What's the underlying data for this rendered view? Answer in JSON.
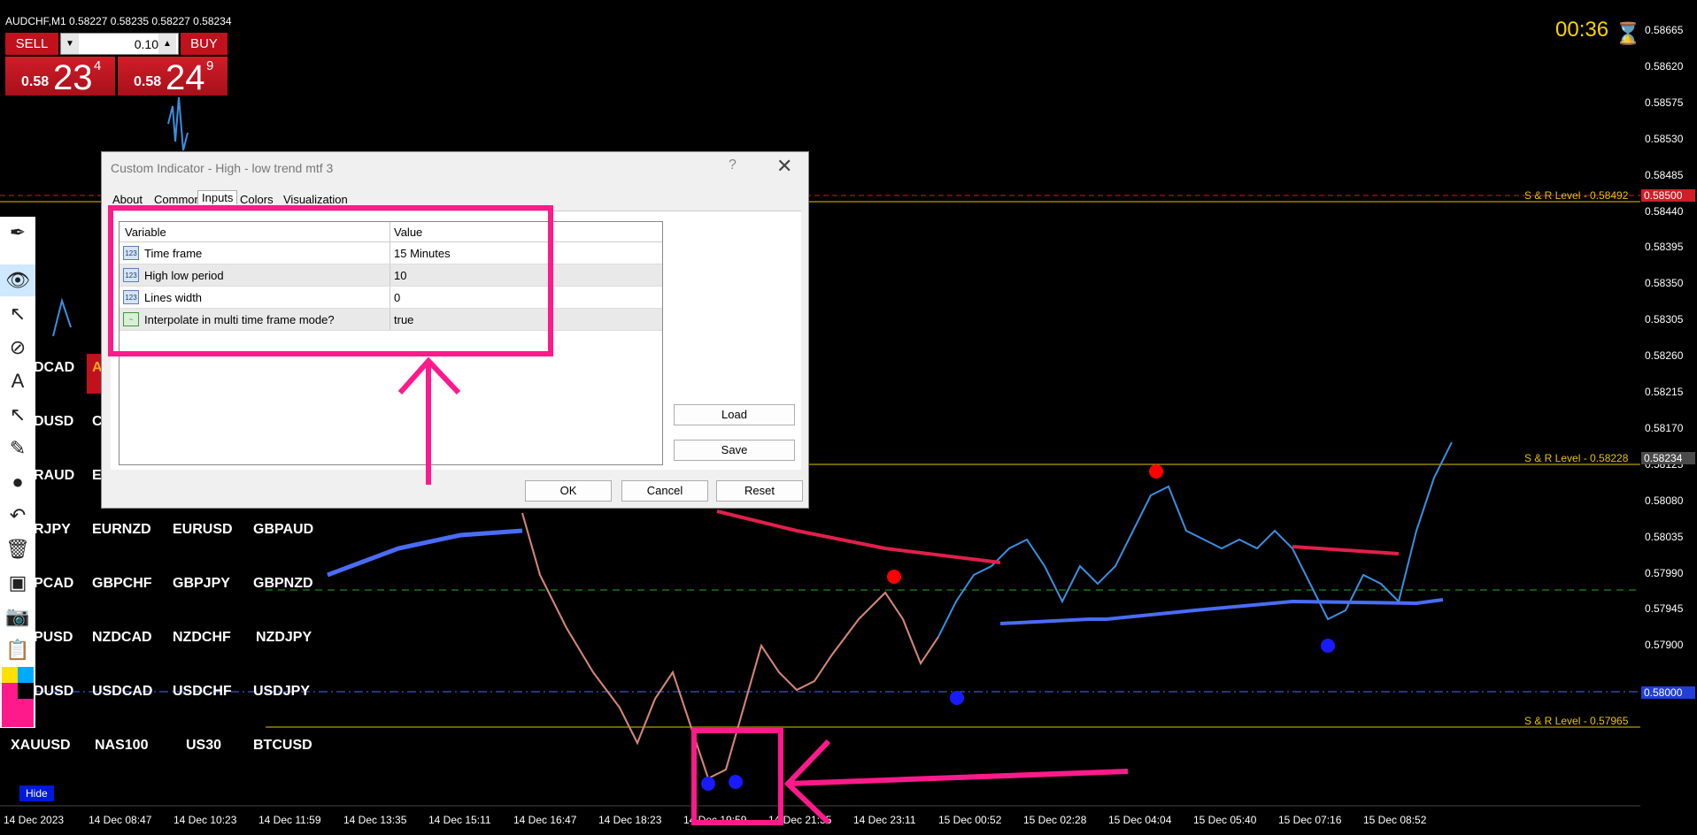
{
  "window": {
    "symbol_title": "AUDCHF,M1  0.58227 0.58235 0.58227 0.58234"
  },
  "trade_panel": {
    "sell_label": "SELL",
    "buy_label": "BUY",
    "lot_value": "0.10",
    "sell_price": {
      "prefix": "0.58",
      "big": "23",
      "sup": "4"
    },
    "buy_price": {
      "prefix": "0.58",
      "big": "24",
      "sup": "9"
    }
  },
  "timer": {
    "value": "00:36",
    "icon": "hourglass-icon"
  },
  "price_axis": {
    "labels": [
      "0.58665",
      "0.58620",
      "0.58575",
      "0.58530",
      "0.58485",
      "0.58440",
      "0.58395",
      "0.58350",
      "0.58305",
      "0.58260",
      "0.58215",
      "0.58170",
      "0.58125",
      "0.58080",
      "0.58035",
      "0.57990",
      "0.57945",
      "0.57900"
    ],
    "tags": [
      {
        "value": "0.58500",
        "color": "#d01d28"
      },
      {
        "value": "0.58234",
        "color": "#4a4a4a"
      },
      {
        "value": "0.58000",
        "color": "#1f3fd6"
      }
    ]
  },
  "sr_levels": [
    {
      "text": "S & R  Level - 0.58492"
    },
    {
      "text": "S & R  Level - 0.58228"
    },
    {
      "text": "S & R  Level - 0.57965"
    }
  ],
  "time_axis": [
    "14 Dec 2023",
    "14 Dec 08:47",
    "14 Dec 10:23",
    "14 Dec 11:59",
    "14 Dec 13:35",
    "14 Dec 15:11",
    "14 Dec 16:47",
    "14 Dec 18:23",
    "14 Dec 19:59",
    "14 Dec 21:35",
    "14 Dec 23:11",
    "15 Dec 00:52",
    "15 Dec 02:28",
    "15 Dec 04:04",
    "15 Dec 05:40",
    "15 Dec 07:16",
    "15 Dec 08:52"
  ],
  "symbol_grid": {
    "rows": [
      [
        "DCAD",
        "A"
      ],
      [
        "DUSD",
        "C"
      ],
      [
        "RAUD",
        "E"
      ],
      [
        "RJPY",
        "EURNZD",
        "EURUSD",
        "GBPAUD"
      ],
      [
        "PCAD",
        "GBPCHF",
        "GBPJPY",
        "GBPNZD"
      ],
      [
        "PUSD",
        "NZDCAD",
        "NZDCHF",
        "NZDJPY"
      ],
      [
        "DUSD",
        "USDCAD",
        "USDCHF",
        "USDJPY"
      ],
      [
        "XAUUSD",
        "NAS100",
        "US30",
        "BTCUSD"
      ]
    ],
    "hide_label": "Hide"
  },
  "toolbar": [
    "pen-icon",
    "eye-icon",
    "cursor-icon",
    "crosshair-icon",
    "text-icon",
    "arrow-icon",
    "ruler-icon",
    "dot-icon",
    "undo-icon",
    "trash-icon",
    "shapes-icon",
    "camera-icon",
    "clipboard-icon",
    "palette-icon"
  ],
  "dialog": {
    "title": "Custom Indicator - High - low trend mtf 3",
    "help_label": "?",
    "close_label": "✕",
    "tabs": [
      "About",
      "Common",
      "Inputs",
      "Colors",
      "Visualization"
    ],
    "active_tab": "Inputs",
    "columns": [
      "Variable",
      "Value"
    ],
    "rows": [
      {
        "icon": "123",
        "variable": "Time frame",
        "value": "15 Minutes"
      },
      {
        "icon": "123",
        "variable": "High low period",
        "value": "10"
      },
      {
        "icon": "123",
        "variable": "Lines width",
        "value": "0"
      },
      {
        "icon": "bool",
        "variable": "Interpolate in multi time frame mode?",
        "value": "true"
      }
    ],
    "buttons": {
      "load": "Load",
      "save": "Save",
      "ok": "OK",
      "cancel": "Cancel",
      "reset": "Reset"
    }
  },
  "colors": {
    "annotation": "#ff1a8c",
    "bull": "#3a8fe0",
    "bear": "#ff7f50",
    "trend_up": "#4a6cf7",
    "trend_down": "#e0204a"
  }
}
